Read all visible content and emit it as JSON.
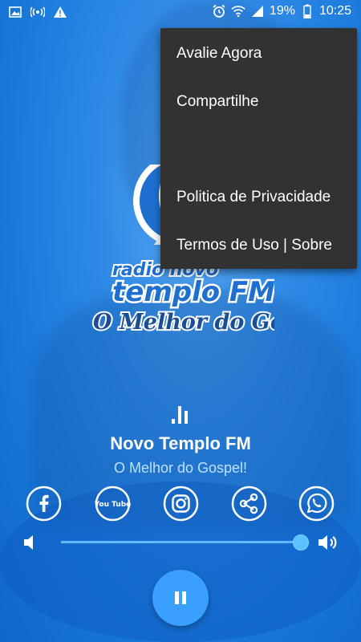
{
  "status_bar": {
    "battery": "19%",
    "time": "10:25",
    "icons": [
      "image-icon",
      "hotspot-icon",
      "warning-icon",
      "alarm-icon",
      "wifi-icon",
      "signal-icon",
      "battery-icon"
    ]
  },
  "logo": {
    "line1": "radio novo",
    "line2": "templo FM",
    "tagline": "O Melhor do Gospel"
  },
  "menu": {
    "items": [
      {
        "label": "Avalie Agora"
      },
      {
        "label": "Compartilhe"
      },
      {
        "label": ""
      },
      {
        "label": "Politica de Privacidade"
      },
      {
        "label": "Termos de Uso | Sobre"
      }
    ]
  },
  "player": {
    "station_name": "Novo Templo FM",
    "station_slogan": "O Melhor do Gospel!",
    "volume": 0.96,
    "state": "playing"
  },
  "social": [
    {
      "icon": "facebook-icon"
    },
    {
      "icon": "youtube-icon",
      "text": "You Tube"
    },
    {
      "icon": "instagram-icon"
    },
    {
      "icon": "share-icon"
    },
    {
      "icon": "whatsapp-icon"
    }
  ],
  "colors": {
    "background": "#1877da",
    "accent": "#3aa0ff",
    "menu_bg": "#323232"
  }
}
